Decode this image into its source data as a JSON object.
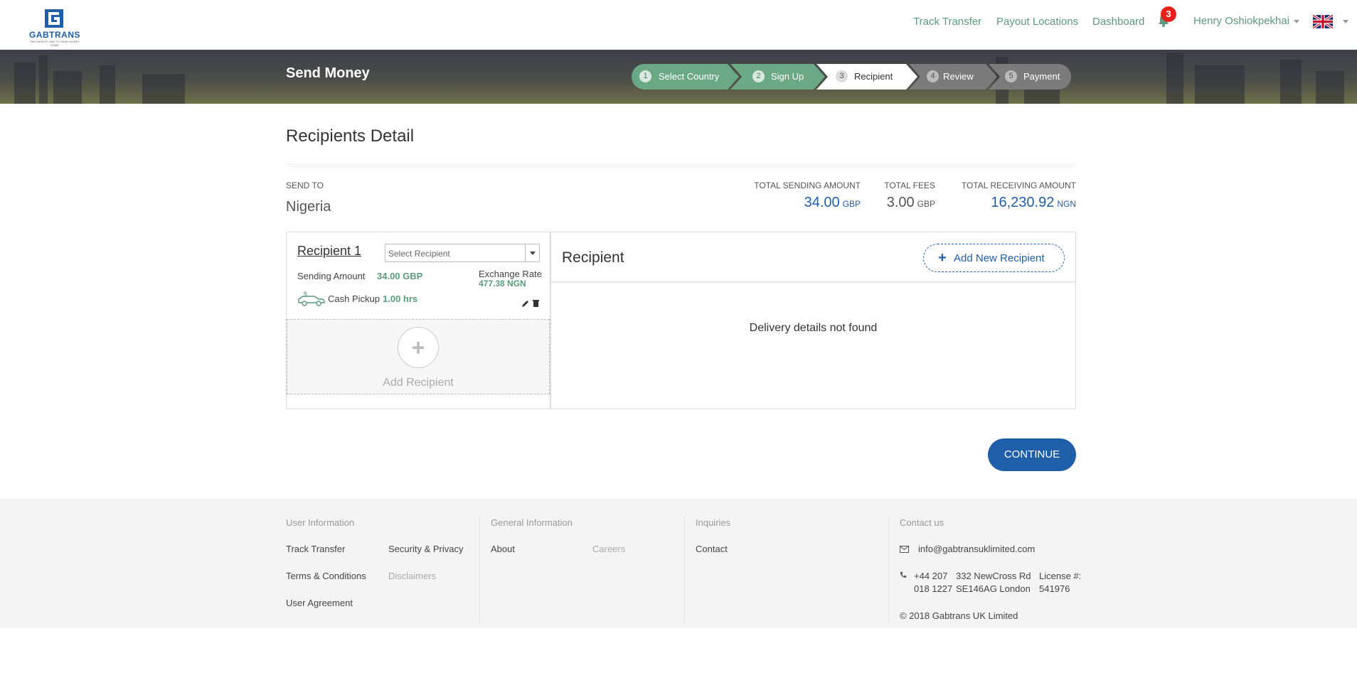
{
  "brand": {
    "name": "GABTRANS",
    "tagline": "THE EASIEST WAY TO SEND MONEY HOME"
  },
  "nav": {
    "links": [
      "Track Transfer",
      "Payout Locations",
      "Dashboard"
    ],
    "notifications": "3",
    "user": "Henry Oshiokpekhai"
  },
  "banner": {
    "title": "Send Money",
    "steps": [
      {
        "num": "1",
        "label": "Select Country",
        "state": "done"
      },
      {
        "num": "2",
        "label": "Sign Up",
        "state": "done"
      },
      {
        "num": "3",
        "label": "Recipient",
        "state": "active"
      },
      {
        "num": "4",
        "label": "Review",
        "state": "todo"
      },
      {
        "num": "5",
        "label": "Payment",
        "state": "todo"
      }
    ]
  },
  "main": {
    "title": "Recipients Detail",
    "send_to_label": "SEND TO",
    "send_to_value": "Nigeria",
    "totals": {
      "sending": {
        "label": "TOTAL SENDING AMOUNT",
        "value": "34.00",
        "currency": "GBP"
      },
      "fees": {
        "label": "TOTAL FEES",
        "value": "3.00",
        "currency": "GBP"
      },
      "receiving": {
        "label": "TOTAL RECEIVING AMOUNT",
        "value": "16,230.92",
        "currency": "NGN"
      }
    }
  },
  "recipient_card": {
    "title": "Recipient 1",
    "select_placeholder": "Select Recipient",
    "sending_amount_label": "Sending Amount",
    "sending_amount_value": "34.00 GBP",
    "exchange_rate_label": "Exchange Rate",
    "exchange_rate_value": "477.38 NGN",
    "delivery_method": "Cash Pickup",
    "delivery_time": "1.00 hrs",
    "add_recipient_label": "Add Recipient"
  },
  "recipient_panel": {
    "title": "Recipient",
    "add_new_label": "Add New Recipient",
    "empty_message": "Delivery details not found"
  },
  "continue_label": "CONTINUE",
  "footer": {
    "user_info": {
      "heading": "User Information",
      "links": [
        "Track Transfer",
        "Security & Privacy",
        "Terms & Conditions",
        "Disclaimers",
        "User Agreement"
      ]
    },
    "general_info": {
      "heading": "General Information",
      "links": [
        "About",
        "Careers"
      ]
    },
    "inquiries": {
      "heading": "Inquiries",
      "links": [
        "Contact"
      ]
    },
    "contact": {
      "heading": "Contact us",
      "email": "info@gabtransuklimited.com",
      "phone_line1": "+44 207",
      "phone_line2": "018 1227",
      "address_line1": "332 NewCross Rd",
      "address_line2": "SE146AG London",
      "license_line1": "License #:",
      "license_line2": "541976",
      "copyright": "© 2018 Gabtrans UK Limited"
    }
  },
  "colors": {
    "brand_blue": "#1f5ea8",
    "green": "#5b9a7c",
    "badge_red": "#e8201a",
    "step_done": "#6aa886",
    "step_todo": "#7b7b7b"
  }
}
